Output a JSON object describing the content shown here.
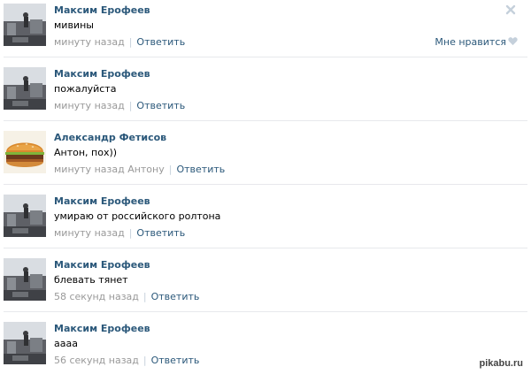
{
  "comments": [
    {
      "author": "Максим Ерофеев",
      "text": "мивины",
      "time": "минуту назад",
      "reply_label": "Ответить",
      "avatar": "photo-avatar"
    },
    {
      "author": "Максим Ерофеев",
      "text": "пожалуйста",
      "time": "минуту назад",
      "reply_label": "Ответить",
      "avatar": "photo-avatar"
    },
    {
      "author": "Александр Фетисов",
      "text": "Антон, пох))",
      "time": "минуту назад Антону",
      "reply_label": "Ответить",
      "avatar": "burger-avatar"
    },
    {
      "author": "Максим Ерофеев",
      "text": "умираю от российского ролтона",
      "time": "минуту назад",
      "reply_label": "Ответить",
      "avatar": "photo-avatar"
    },
    {
      "author": "Максим Ерофеев",
      "text": "блевать тянет",
      "time": "58 секунд назад",
      "reply_label": "Ответить",
      "avatar": "photo-avatar"
    },
    {
      "author": "Максим Ерофеев",
      "text": "аааа",
      "time": "56 секунд назад",
      "reply_label": "Ответить",
      "avatar": "photo-avatar"
    }
  ],
  "first_comment_actions": {
    "like_label": "Мне нравится",
    "like_icon": "heart-icon",
    "close_icon": "close-icon"
  },
  "watermark": "pikabu.ru",
  "colors": {
    "link": "#2b587a",
    "muted": "#999999",
    "separator": "#c5d0db",
    "divider": "#e7e8ec"
  }
}
